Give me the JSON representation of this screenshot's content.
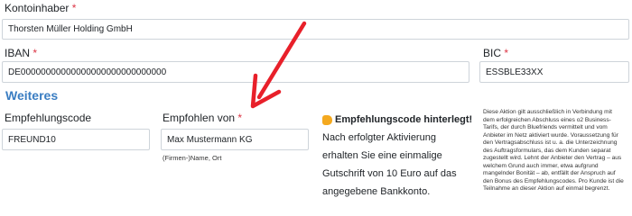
{
  "account_holder": {
    "label": "Kontoinhaber",
    "required_mark": "*",
    "value": "Thorsten Müller Holding GmbH"
  },
  "iban": {
    "label": "IBAN",
    "required_mark": "*",
    "value": "DE00000000000000000000000000000"
  },
  "bic": {
    "label": "BIC",
    "required_mark": "*",
    "value": "ESSBLE33XX"
  },
  "section": {
    "title": "Weiteres"
  },
  "referral_code": {
    "label": "Empfehlungscode",
    "value": "FREUND10"
  },
  "recommended_by": {
    "label": "Empfohlen von",
    "required_mark": "*",
    "value": "Max Mustermann KG",
    "hint": "(Firmen-)Name, Ort"
  },
  "promo": {
    "icon": "thumbs-up-icon",
    "heading": "Empfehlungscode hinterlegt!",
    "lines": [
      "Nach erfolgter Aktivierung",
      "erhalten Sie eine einmalige",
      "Gutschrift von 10 Euro auf das",
      "angegebene Bankkonto."
    ]
  },
  "fine_print": {
    "lines": [
      "Diese Aktion gilt ausschließlich in Verbindung mit",
      "dem erfolgreichen Abschluss eines o2 Business-",
      "Tarifs, der durch Bluefriends vermittelt und vom",
      "Anbieter im Netz aktiviert wurde. Voraussetzung für",
      "den Vertragsabschluss ist u. a. die Unterzeichnung",
      "des Auftragsformulars, das dem Kunden separat",
      "zugestellt wird. Lehnt der Anbieter den Vertrag – aus",
      "welchem Grund auch immer, etwa aufgrund",
      "mangelnder Bonität – ab, entfällt der Anspruch auf",
      "den Bonus des Empfehlungscodes. Pro Kunde ist die",
      "Teilnahme an dieser Aktion auf einmal begrenzt."
    ]
  },
  "colors": {
    "accent": "#3a7dc2",
    "required": "#dc3545",
    "arrow": "#e8202a"
  }
}
